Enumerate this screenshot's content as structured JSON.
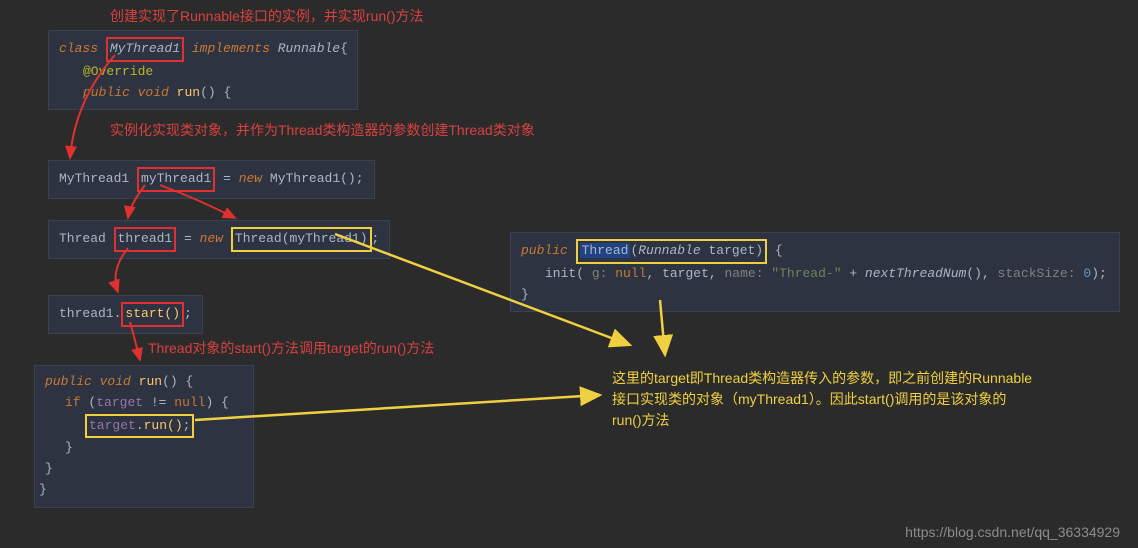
{
  "annotations": {
    "a1": "创建实现了Runnable接口的实例，并实现run()方法",
    "a2": "实例化实现类对象，并作为Thread类构造器的参数创建Thread类对象",
    "a3": "Thread对象的start()方法调用target的run()方法",
    "a4_line1": "这里的target即Thread类构造器传入的参数，即之前创建的Runnable",
    "a4_line2": "接口实现类的对象（myThread1）。因此start()调用的是该对象的",
    "a4_line3": "run()方法"
  },
  "code": {
    "box1": {
      "class_kw": "class",
      "class_name": "MyThread1",
      "implements_kw": "implements",
      "impl_name": "Runnable",
      "brace_open": "{",
      "override": "@Override",
      "public_kw": "public",
      "void_kw": "void",
      "run": "run",
      "parens": "() {"
    },
    "box2": {
      "type": "MyThread1",
      "var": "myThread1",
      "equals": "=",
      "new_kw": "new",
      "ctor": "MyThread1",
      "tail": "();"
    },
    "box3": {
      "type": "Thread",
      "var": "thread1",
      "equals": "=",
      "new_kw": "new",
      "ctor": "Thread",
      "arg": "myThread1",
      "tail": ";"
    },
    "box4": {
      "obj": "thread1",
      "dot": ".",
      "start": "start()",
      "tail": ";"
    },
    "box5": {
      "public_kw": "public",
      "void_kw": "void",
      "run": "run",
      "sig": "() {",
      "if_kw": "if",
      "cond_open": "(",
      "target": "target",
      "cond_rest": " != ",
      "null_kw": "null",
      "cond_close": ") {",
      "target2": "target",
      "dot": ".",
      "call": "run()",
      "semi": ";",
      "brace_close1": "}",
      "brace_close2": "}",
      "brace_close3": "}"
    },
    "box6": {
      "public_kw": "public",
      "ctor": "Thread",
      "param_type": "Runnable",
      "param_name": "target",
      "sig_close": ") {",
      "init": "init(",
      "g": " g: ",
      "null1": "null",
      "c1": ", ",
      "target": "target",
      "c2": ", ",
      "name_lbl": " name: ",
      "str": "\"Thread-\"",
      "plus": " + ",
      "next": "nextThreadNum",
      "next_tail": "(),",
      "stack_lbl": "  stackSize: ",
      "zero": "0",
      "tail": ");",
      "brace_close": "}"
    }
  },
  "watermark": "https://blog.csdn.net/qq_36334929"
}
